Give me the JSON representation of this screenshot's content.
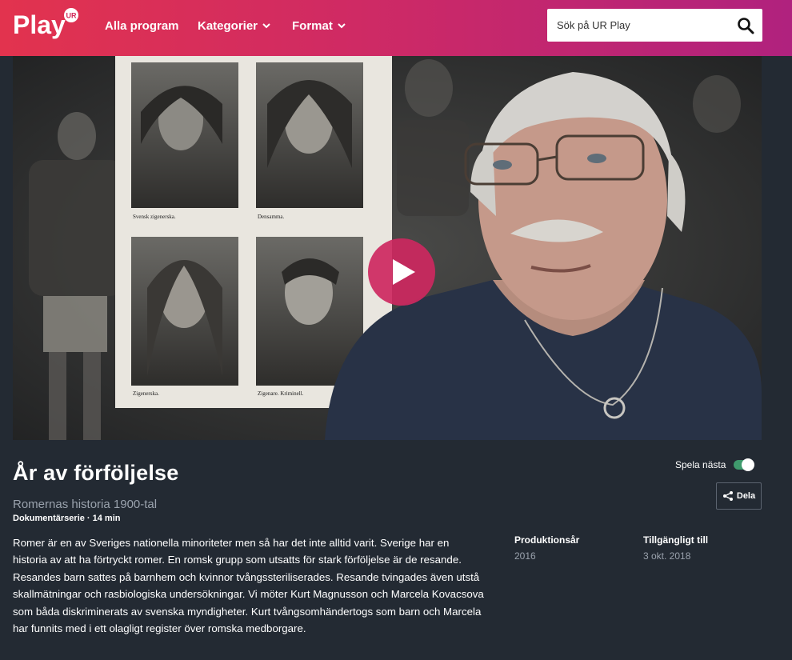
{
  "header": {
    "logo_text": "Play",
    "logo_badge": "UR",
    "nav": [
      {
        "label": "Alla program"
      },
      {
        "label": "Kategorier"
      },
      {
        "label": "Format"
      }
    ],
    "search": {
      "placeholder": "Sök på UR Play"
    }
  },
  "player": {
    "photo_captions": [
      "Svensk zigenerska.",
      "Densamma.",
      "Zigenerska.",
      "Zigenare. Kriminell."
    ]
  },
  "program": {
    "title": "År av förföljelse",
    "series": "Romernas historia 1900-tal",
    "meta": "Dokumentärserie · 14 min",
    "description": "Romer är en av Sveriges nationella minoriteter men så har det inte alltid varit. Sverige har en historia av att ha förtryckt romer. En romsk grupp som utsatts för stark förföljelse är de resande. Resandes barn sattes på barnhem och kvinnor tvångssteriliserades. Resande tvingades även utstå skallmätningar och rasbiologiska undersökningar. Vi möter Kurt Magnusson och Marcela Kovacsova som båda diskriminerats av svenska myndigheter. Kurt tvångsomhändertogs som barn och Marcela har funnits med i ett olagligt register över romska medborgare."
  },
  "autoplay": {
    "label": "Spela nästa",
    "enabled": true
  },
  "share": {
    "label": "Dela"
  },
  "facts": [
    {
      "label": "Produktionsår",
      "value": "2016"
    },
    {
      "label": "Tillgängligt till",
      "value": "3 okt. 2018"
    }
  ],
  "colors": {
    "header_start": "#e2334e",
    "header_end": "#b0227e",
    "background": "#232a33",
    "play_button": "#cd285f",
    "toggle_on": "#3f9a6d"
  }
}
